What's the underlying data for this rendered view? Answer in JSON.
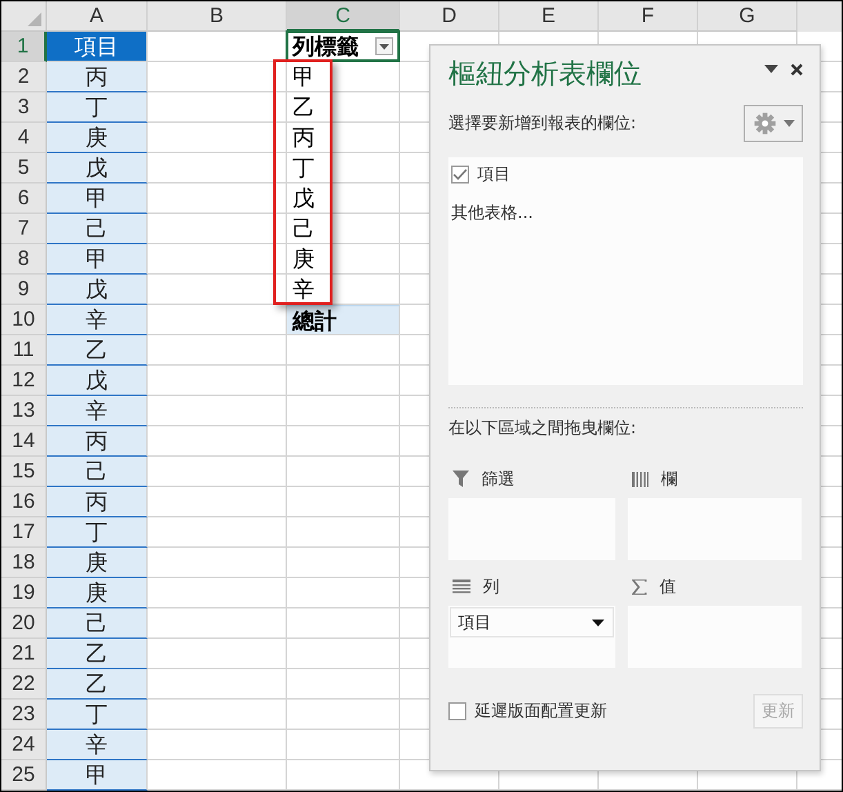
{
  "sheet": {
    "columns": [
      {
        "label": "A",
        "selected": false
      },
      {
        "label": "B",
        "selected": false
      },
      {
        "label": "C",
        "selected": true
      },
      {
        "label": "D",
        "selected": false
      },
      {
        "label": "E",
        "selected": false
      },
      {
        "label": "F",
        "selected": false
      },
      {
        "label": "G",
        "selected": false
      }
    ],
    "rows": [
      {
        "label": "1",
        "selected": true
      },
      {
        "label": "2",
        "selected": false
      },
      {
        "label": "3",
        "selected": false
      },
      {
        "label": "4",
        "selected": false
      },
      {
        "label": "5",
        "selected": false
      },
      {
        "label": "6",
        "selected": false
      },
      {
        "label": "7",
        "selected": false
      },
      {
        "label": "8",
        "selected": false
      },
      {
        "label": "9",
        "selected": false
      },
      {
        "label": "10",
        "selected": false
      },
      {
        "label": "11",
        "selected": false
      },
      {
        "label": "12",
        "selected": false
      },
      {
        "label": "13",
        "selected": false
      },
      {
        "label": "14",
        "selected": false
      },
      {
        "label": "15",
        "selected": false
      },
      {
        "label": "16",
        "selected": false
      },
      {
        "label": "17",
        "selected": false
      },
      {
        "label": "18",
        "selected": false
      },
      {
        "label": "19",
        "selected": false
      },
      {
        "label": "20",
        "selected": false
      },
      {
        "label": "21",
        "selected": false
      },
      {
        "label": "22",
        "selected": false
      },
      {
        "label": "23",
        "selected": false
      },
      {
        "label": "24",
        "selected": false
      },
      {
        "label": "25",
        "selected": false
      }
    ],
    "table": {
      "header": "項目",
      "items": [
        "丙",
        "丁",
        "庚",
        "戊",
        "甲",
        "己",
        "甲",
        "戊",
        "辛",
        "乙",
        "戊",
        "辛",
        "丙",
        "己",
        "丙",
        "丁",
        "庚",
        "庚",
        "己",
        "乙",
        "乙",
        "丁",
        "辛",
        "甲"
      ]
    },
    "pivot": {
      "header": "列標籤",
      "items": [
        "甲",
        "乙",
        "丙",
        "丁",
        "戊",
        "己",
        "庚",
        "辛"
      ],
      "total": "總計",
      "highlighted": true
    }
  },
  "pivot_panel": {
    "title": "樞紐分析表欄位",
    "prompt": "選擇要新增到報表的欄位:",
    "fields": [
      {
        "label": "項目",
        "checked": true
      }
    ],
    "more_tables": "其他表格...",
    "areas_prompt": "在以下區域之間拖曳欄位:",
    "areas": [
      {
        "kind": "filters",
        "label": "篩選"
      },
      {
        "kind": "columns",
        "label": "欄"
      },
      {
        "kind": "rows",
        "label": "列",
        "items": [
          "項目"
        ]
      },
      {
        "kind": "values",
        "label": "值"
      }
    ],
    "defer": {
      "label": "延遲版面配置更新",
      "checked": false
    },
    "update_button": {
      "label": "更新",
      "disabled": true
    }
  }
}
